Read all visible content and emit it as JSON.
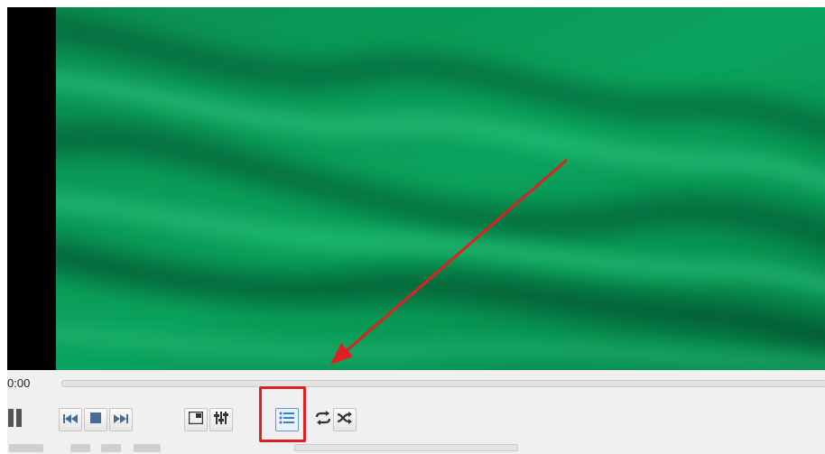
{
  "player": {
    "time": {
      "elapsed": "0:00"
    },
    "seek": {
      "position": 0.0
    },
    "controls": {
      "pause": {
        "icon": "pause-icon"
      },
      "previous": {
        "icon": "skip-previous-icon"
      },
      "stop": {
        "icon": "stop-icon"
      },
      "next": {
        "icon": "skip-next-icon"
      },
      "fullscreen": {
        "icon": "fullscreen-toggle-icon"
      },
      "extended_settings": {
        "icon": "equalizer-sliders-icon"
      },
      "playlist": {
        "icon": "playlist-icon",
        "active": true
      },
      "loop": {
        "icon": "loop-icon"
      },
      "shuffle": {
        "icon": "shuffle-icon"
      }
    },
    "colors": {
      "video_green": "#0a9a58",
      "annotation_red": "#e02020",
      "toolbar_bg": "#f0f0f0"
    }
  }
}
